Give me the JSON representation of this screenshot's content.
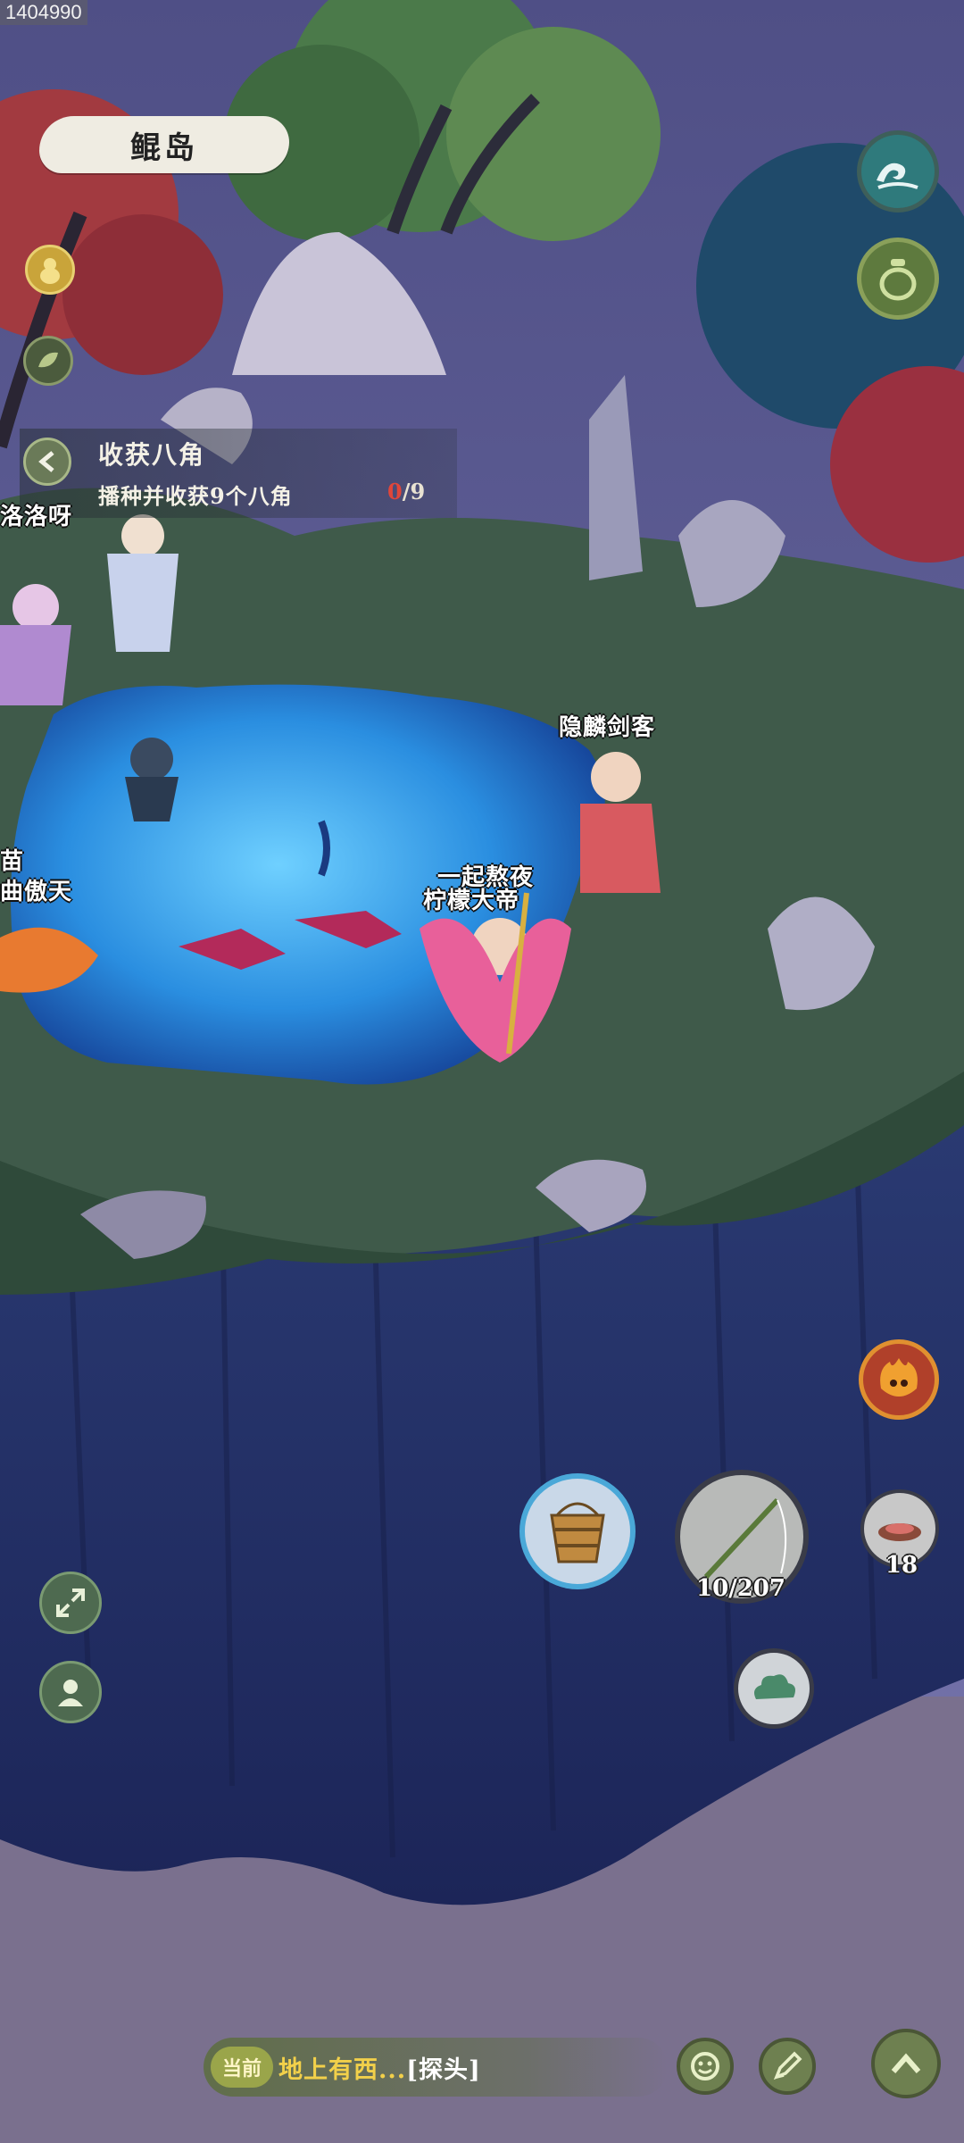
{
  "screen_id": "1404990",
  "location": {
    "name": "鲲岛"
  },
  "quest": {
    "title": "收获八角",
    "description": "播种并收获9个八角",
    "progress_current": "0",
    "progress_total": "/9"
  },
  "name_tags": {
    "left_top": "洛洛呀",
    "left_mid_1": "苗",
    "left_mid_2": "曲傲天",
    "npc": "隐麟剑客",
    "player_line1": "一起熬夜",
    "player_line2": "柠檬大帝"
  },
  "counters": {
    "fishing_rod": "10/207",
    "bait": "18"
  },
  "bottom_bar": {
    "current_label": "当前",
    "message": "地上有西...",
    "action": "[探头]"
  },
  "icons": {
    "top_right_1": "wave-icon",
    "top_right_2": "jar-icon",
    "left_1": "gourd-icon",
    "left_2": "leaf-icon",
    "buddy": "fire-spirit-icon",
    "bucket": "bucket-icon",
    "rod": "fishing-rod-icon",
    "bait": "bait-icon",
    "cloud": "cloud-icon",
    "expand": "expand-icon",
    "avatar": "person-icon",
    "emote": "smile-icon",
    "edit": "pen-icon",
    "collapse": "chevron-up-icon"
  }
}
